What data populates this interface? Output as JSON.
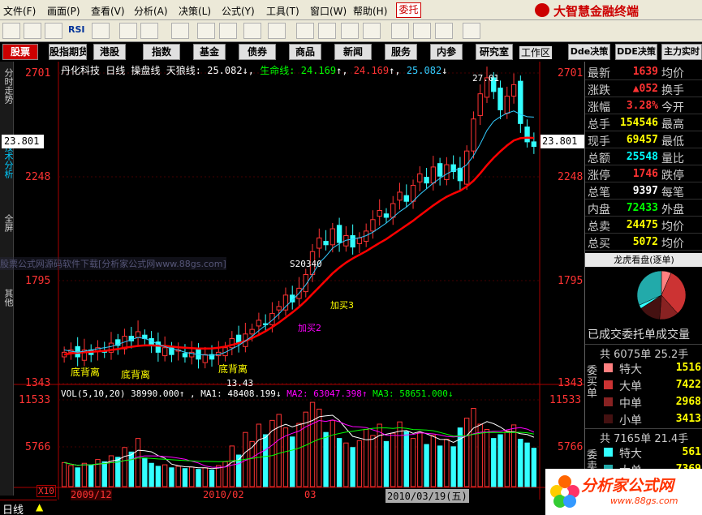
{
  "menu": [
    "文件(F)",
    "画面(P)",
    "查看(V)",
    "分析(A)",
    "决策(L)",
    "公式(Y)",
    "工具(T)",
    "窗口(W)",
    "帮助(H)"
  ],
  "weituo": "委托",
  "brand": "大智慧金融终端",
  "toolbar_rsi": "RSI",
  "functions": [
    "股票",
    "股指期货",
    "港股",
    "指数",
    "基金",
    "债券",
    "商品",
    "新闻",
    "服务",
    "内参",
    "研究室"
  ],
  "work_area": "工作区",
  "right_functions": [
    "Dde决策",
    "DDE决策",
    "主力实时"
  ],
  "left_tabs": [
    "分时走势",
    "技术分析",
    "全屏",
    "其他"
  ],
  "chart_header": {
    "stock": "丹化科技",
    "period": "日线",
    "indicator": "操盘线",
    "tl_label": "天狼线:",
    "tl_val": "25.082",
    "sm_label": "生命线:",
    "sm_val": "24.169",
    "v3": "24.169",
    "v4": "25.082"
  },
  "watermark": "股票公式网源码软件下载[分析家公式网www.88gs.com]",
  "annotations": {
    "top": "27.01",
    "s": "S20340",
    "buy2": "加买2",
    "buy3": "加买3",
    "bottom": "13.43",
    "div1": "底背离",
    "div2": "底背离",
    "div3": "底背离"
  },
  "price_axis": [
    "2701",
    "2248",
    "1795",
    "1343"
  ],
  "current_price": "23.801",
  "vol_header": {
    "vol": "VOL(5,10,20)",
    "vol_val": "38990.000↑",
    "ma1": "MA1: 48408.199↓",
    "ma2": "MA2: 63047.398↑",
    "ma3": "MA3: 58651.000↓"
  },
  "vol_axis": [
    "11533",
    "5766"
  ],
  "vol_unit": "X10",
  "period_tab": "日线",
  "date_axis": [
    "2009/12",
    "2010/02",
    "03",
    "2010/03/19(五)"
  ],
  "quote": [
    {
      "l1": "最新",
      "v1": "1639",
      "l2": "均价",
      "c": "#ff3333"
    },
    {
      "l1": "涨跌",
      "v1": "▲052",
      "l2": "换手",
      "c": "#ff3333"
    },
    {
      "l1": "涨幅",
      "v1": "3.28%",
      "l2": "今开",
      "c": "#ff3333"
    },
    {
      "l1": "总手",
      "v1": "154546",
      "l2": "最高",
      "c": "#ffff00"
    },
    {
      "l1": "现手",
      "v1": "69457",
      "l2": "最低",
      "c": "#ffff00"
    },
    {
      "l1": "总额",
      "v1": "25548",
      "l2": "量比",
      "c": "#00ffff"
    },
    {
      "l1": "涨停",
      "v1": "1746",
      "l2": "跌停",
      "c": "#ff3333"
    },
    {
      "l1": "总笔",
      "v1": "9397",
      "l2": "每笔",
      "c": "#ffffff"
    },
    {
      "l1": "内盘",
      "v1": "72433",
      "l2": "外盘",
      "c": "#00ff00"
    },
    {
      "l1": "总卖",
      "v1": "24475",
      "l2": "均价",
      "c": "#ffff00"
    },
    {
      "l1": "总买",
      "v1": "5072",
      "l2": "均价",
      "c": "#ffff00"
    }
  ],
  "longhu_title": "龙虎看盘(逐单)",
  "yiche": "已成交委托单成交量",
  "buy_block": {
    "header": "共 6075单 25.2手",
    "side": "委买单",
    "rows": [
      {
        "label": "特大",
        "value": "1516",
        "color": "#ff8080"
      },
      {
        "label": "大单",
        "value": "7422",
        "color": "#cc3333"
      },
      {
        "label": "中单",
        "value": "2968",
        "color": "#882222"
      },
      {
        "label": "小单",
        "value": "3413",
        "color": "#441111"
      }
    ]
  },
  "sell_block": {
    "header": "共 7165单 21.4手",
    "side": "委卖单",
    "rows": [
      {
        "label": "特大",
        "value": "561",
        "color": "#33ffff"
      },
      {
        "label": "大单",
        "value": "7369",
        "color": "#22aaaa"
      }
    ]
  },
  "logo": {
    "title": "分析家公式网",
    "url": "www.88gs.com"
  },
  "colors": {
    "up": "#ff3333",
    "down": "#33ffff",
    "ma_red": "#ff0000",
    "ma_white": "#ffffff",
    "ma_yellow": "#ffff00",
    "ma_magenta": "#ff00ff",
    "ma_green": "#00ff00"
  },
  "series_prices": [
    14.8,
    14.9,
    14.6,
    14.9,
    14.7,
    15.0,
    14.8,
    15.2,
    15.1,
    15.5,
    15.3,
    15.7,
    15.4,
    15.1,
    14.8,
    15.0,
    14.7,
    14.9,
    14.6,
    14.8,
    14.5,
    14.7,
    14.5,
    14.8,
    15.0,
    15.4,
    15.2,
    15.6,
    15.8,
    16.2,
    16.0,
    16.5,
    16.8,
    17.3,
    17.0,
    17.6,
    18.2,
    19.2,
    19.8,
    19.5,
    20.2,
    19.6,
    19.9,
    19.4,
    19.8,
    20.1,
    20.6,
    21.0,
    20.7,
    21.3,
    21.8,
    21.4,
    22.1,
    22.6,
    22.2,
    22.9,
    22.5,
    23.0,
    22.7,
    22.3,
    23.6,
    25.0,
    26.1,
    26.8,
    26.2,
    25.4,
    26.0,
    26.5,
    24.8,
    24.0,
    23.8
  ],
  "series_volumes": [
    3200,
    2800,
    2500,
    3100,
    2900,
    3600,
    3300,
    4100,
    3900,
    5200,
    4600,
    6400,
    3800,
    3100,
    2700,
    2900,
    2500,
    2700,
    2400,
    2600,
    2300,
    2500,
    2200,
    2800,
    3300,
    5400,
    4200,
    7200,
    6000,
    8300,
    6900,
    8800,
    9600,
    7800,
    6600,
    8400,
    9900,
    11200,
    10300,
    7200,
    8800,
    6400,
    5800,
    5200,
    6100,
    7600,
    6800,
    8300,
    6000,
    7100,
    8600,
    7300,
    6400,
    7200,
    5600,
    6800,
    5400,
    6300,
    5300,
    7800,
    9100,
    10400,
    8300,
    7600,
    6400,
    6900,
    7400,
    8200,
    6300,
    5800,
    5100
  ],
  "ma_red_series": [
    14.7,
    14.75,
    14.78,
    14.8,
    14.82,
    14.84,
    14.86,
    14.9,
    14.94,
    15.0,
    15.04,
    15.08,
    15.1,
    15.1,
    15.09,
    15.08,
    15.05,
    15.02,
    15.0,
    14.98,
    14.96,
    14.96,
    14.97,
    15.0,
    15.05,
    15.12,
    15.2,
    15.3,
    15.42,
    15.56,
    15.72,
    15.9,
    16.1,
    16.32,
    16.54,
    16.78,
    17.05,
    17.35,
    17.65,
    17.95,
    18.25,
    18.5,
    18.72,
    18.9,
    19.06,
    19.22,
    19.4,
    19.58,
    19.75,
    19.95,
    20.15,
    20.35,
    20.55,
    20.78,
    21.0,
    21.22,
    21.42,
    21.6,
    21.74,
    21.86,
    22.05,
    22.3,
    22.62,
    22.98,
    23.3,
    23.58,
    23.84,
    24.06,
    24.16,
    24.18,
    24.17
  ],
  "ma_white_series": [
    14.9,
    14.85,
    14.8,
    14.85,
    14.9,
    14.95,
    15.0,
    15.05,
    15.15,
    15.25,
    15.35,
    15.45,
    15.4,
    15.3,
    15.15,
    15.05,
    14.95,
    14.9,
    14.8,
    14.75,
    14.7,
    14.68,
    14.66,
    14.7,
    14.8,
    14.95,
    15.1,
    15.3,
    15.5,
    15.75,
    15.98,
    16.2,
    16.48,
    16.8,
    17.08,
    17.38,
    17.75,
    18.2,
    18.7,
    19.0,
    19.35,
    19.55,
    19.7,
    19.75,
    19.8,
    19.9,
    20.05,
    20.25,
    20.45,
    20.7,
    20.95,
    21.15,
    21.4,
    21.7,
    21.95,
    22.2,
    22.4,
    22.6,
    22.75,
    22.8,
    23.0,
    23.4,
    23.9,
    24.5,
    24.9,
    25.1,
    25.25,
    25.35,
    25.2,
    25.1,
    25.08
  ]
}
